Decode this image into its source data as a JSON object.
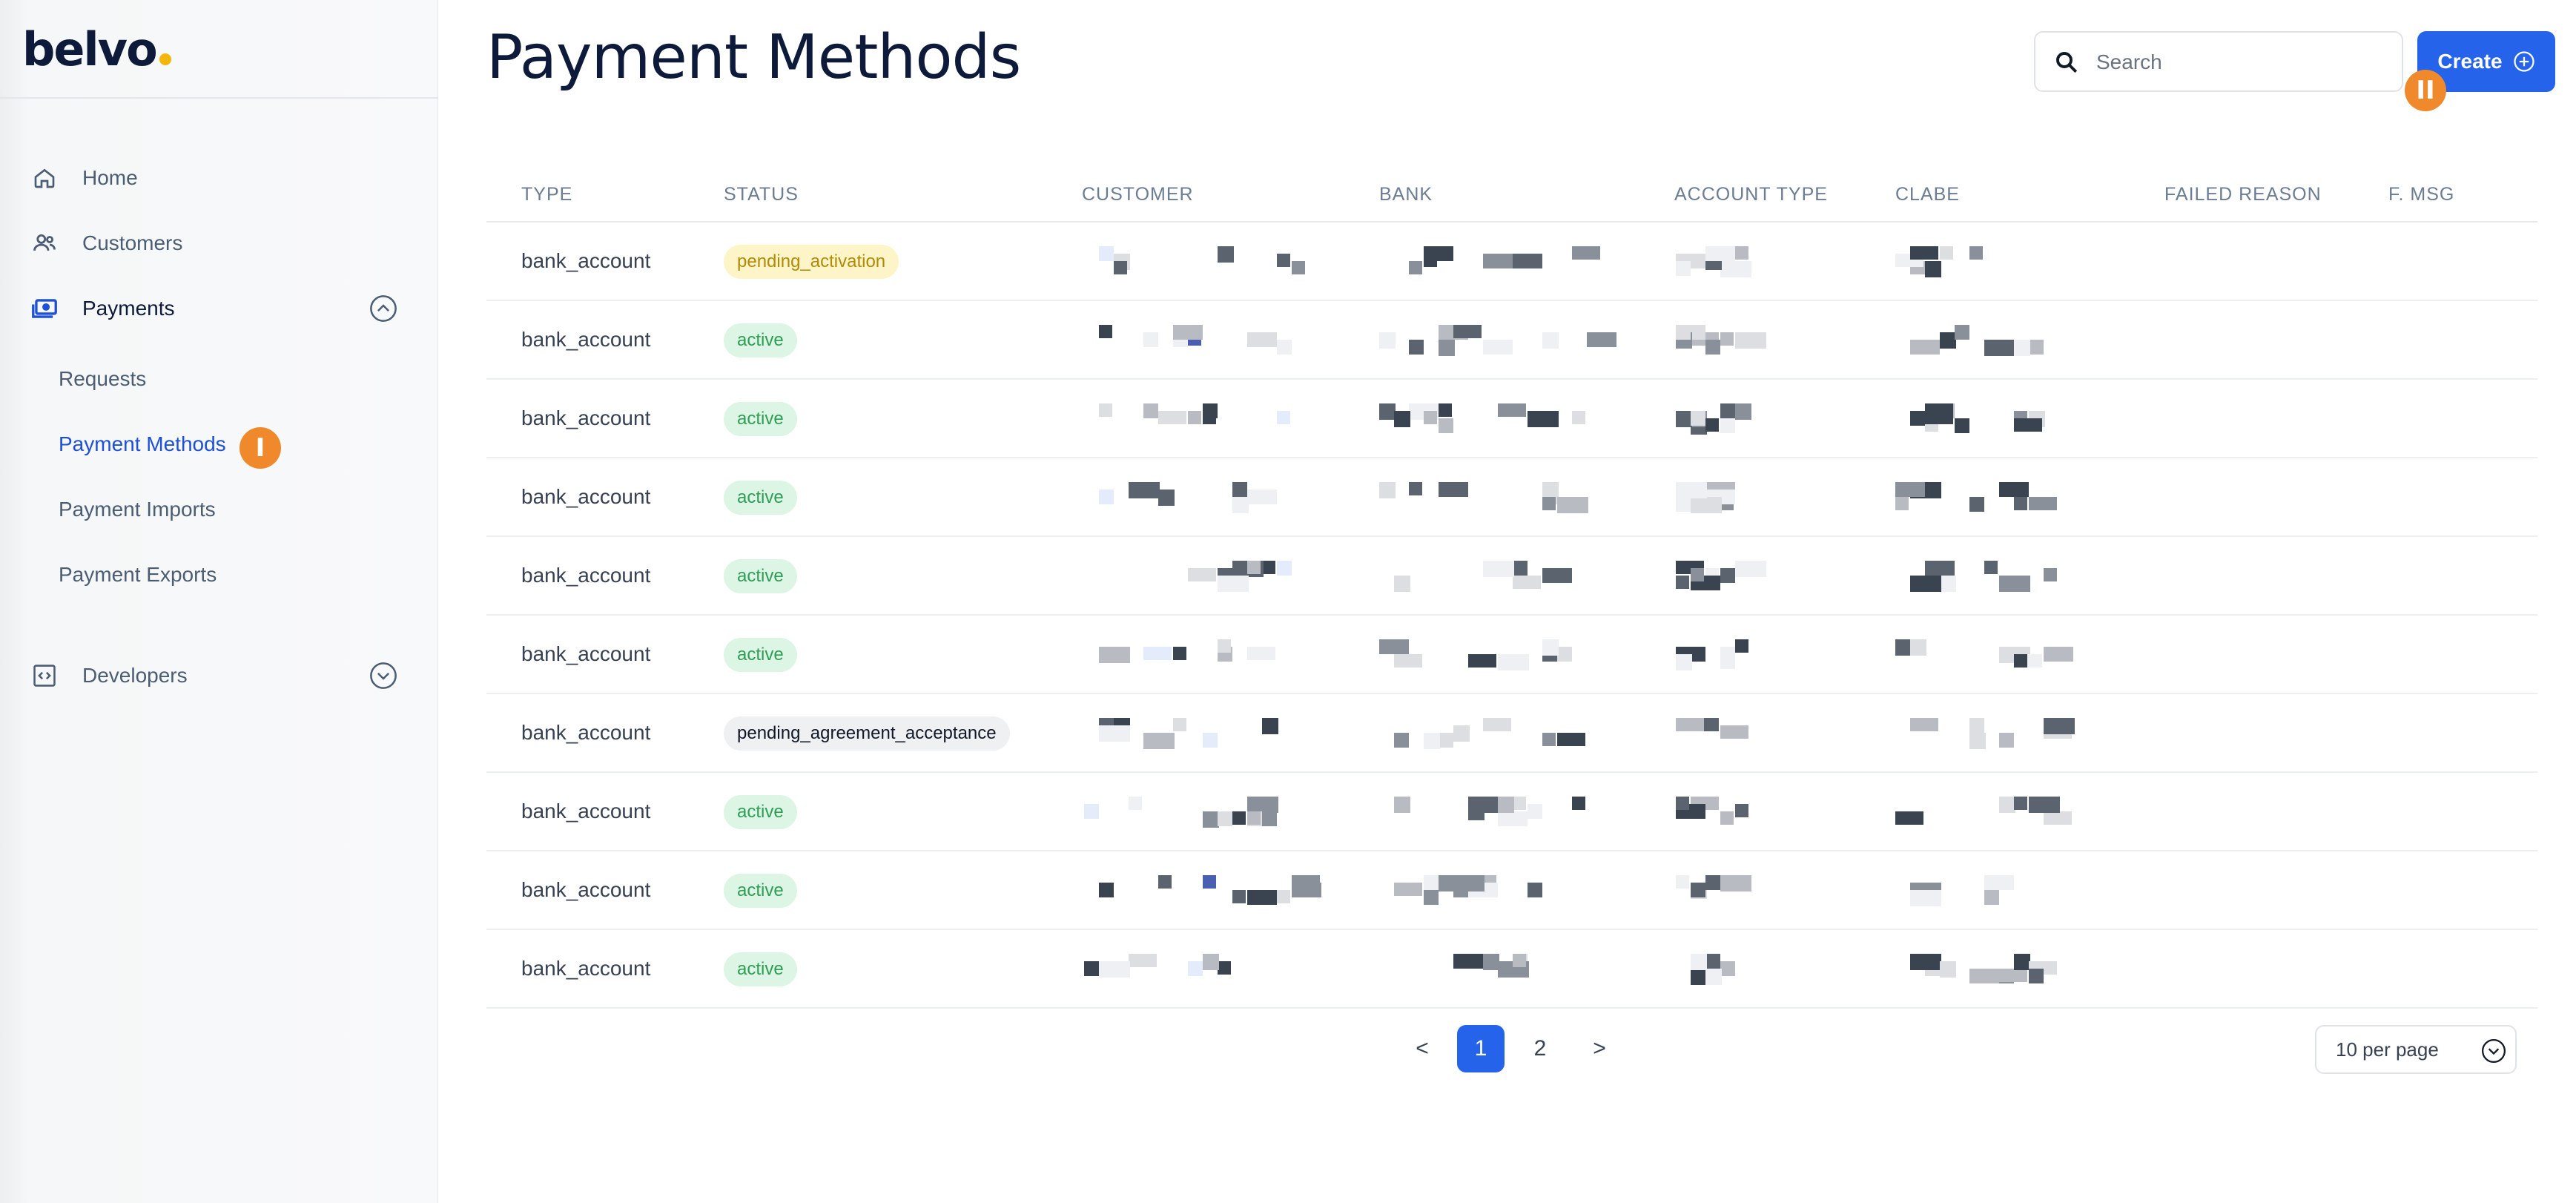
{
  "brand": {
    "logo_text": "belvo",
    "logo_dot_color": "#f5b60b"
  },
  "sidebar": {
    "items": [
      {
        "label": "Home",
        "icon": "home-icon"
      },
      {
        "label": "Customers",
        "icon": "users-icon"
      },
      {
        "label": "Payments",
        "icon": "payments-icon",
        "expanded": true
      },
      {
        "label": "Developers",
        "icon": "code-icon",
        "expanded": false
      }
    ],
    "payments_subitems": [
      {
        "label": "Requests"
      },
      {
        "label": "Payment Methods",
        "active": true
      },
      {
        "label": "Payment Imports"
      },
      {
        "label": "Payment Exports"
      }
    ]
  },
  "markers": {
    "first": "I",
    "second": "II"
  },
  "header": {
    "title": "Payment Methods"
  },
  "search": {
    "placeholder": "Search",
    "value": ""
  },
  "create_button": {
    "label": "Create"
  },
  "table": {
    "columns": [
      "TYPE",
      "STATUS",
      "CUSTOMER",
      "BANK",
      "ACCOUNT TYPE",
      "CLABE",
      "FAILED REASON",
      "F. MSG"
    ],
    "rows": [
      {
        "type": "bank_account",
        "status": "pending_activation"
      },
      {
        "type": "bank_account",
        "status": "active"
      },
      {
        "type": "bank_account",
        "status": "active"
      },
      {
        "type": "bank_account",
        "status": "active"
      },
      {
        "type": "bank_account",
        "status": "active"
      },
      {
        "type": "bank_account",
        "status": "active"
      },
      {
        "type": "bank_account",
        "status": "pending_agreement_acceptance"
      },
      {
        "type": "bank_account",
        "status": "active"
      },
      {
        "type": "bank_account",
        "status": "active"
      },
      {
        "type": "bank_account",
        "status": "active"
      }
    ]
  },
  "pagination": {
    "prev": "<",
    "pages": [
      "1",
      "2"
    ],
    "current": "1",
    "next": ">",
    "per_page": "10 per page"
  },
  "colors": {
    "accent": "#2563eb",
    "marker": "#f0892c",
    "active_badge_bg": "#dcf5e4",
    "pending_badge_bg": "#fdf5c8"
  }
}
